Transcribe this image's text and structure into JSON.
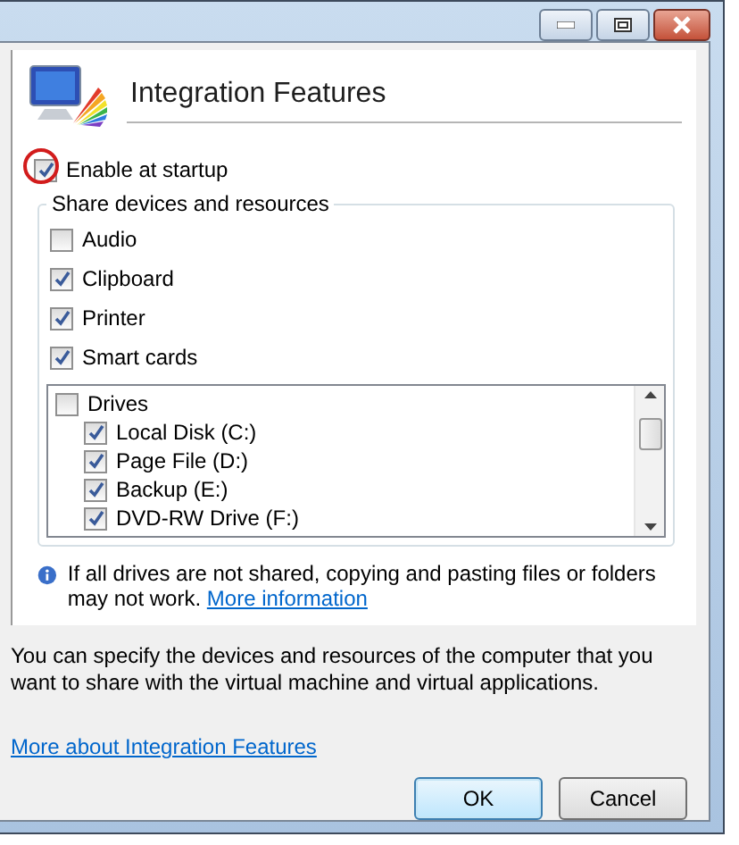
{
  "header": {
    "title": "Integration Features"
  },
  "startup": {
    "label": "Enable at startup",
    "checked": true,
    "highlighted": true
  },
  "group": {
    "title": "Share devices and resources",
    "items": [
      {
        "label": "Audio",
        "checked": false
      },
      {
        "label": "Clipboard",
        "checked": true
      },
      {
        "label": "Printer",
        "checked": true
      },
      {
        "label": "Smart cards",
        "checked": true
      }
    ]
  },
  "drives": [
    {
      "label": "Drives",
      "checked": false,
      "children": [
        {
          "label": "Local Disk (C:)",
          "checked": true
        },
        {
          "label": "Page File (D:)",
          "checked": true
        },
        {
          "label": "Backup (E:)",
          "checked": true
        },
        {
          "label": "DVD-RW Drive (F:)",
          "checked": true
        }
      ]
    }
  ],
  "info": {
    "text": "If all drives are not shared, copying and pasting files or folders may not work.",
    "link": "More information"
  },
  "description": "You can specify the devices and resources of the computer that you want to share with the virtual machine and virtual applications.",
  "link": "More about Integration Features",
  "buttons": [
    {
      "label": "OK",
      "default": true
    },
    {
      "label": "Cancel",
      "default": false
    }
  ]
}
